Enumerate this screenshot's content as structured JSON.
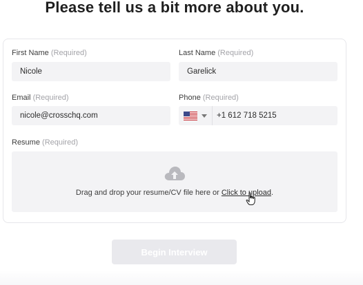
{
  "heading": "Please tell us a bit more about you.",
  "required_tag": "(Required)",
  "fields": {
    "first_name": {
      "label": "First Name",
      "value": "Nicole"
    },
    "last_name": {
      "label": "Last Name",
      "value": "Garelick"
    },
    "email": {
      "label": "Email",
      "value": "nicole@crosschq.com"
    },
    "phone": {
      "label": "Phone",
      "value": "+1 612 718 5215",
      "country": "United States"
    }
  },
  "resume": {
    "label": "Resume",
    "drop_text": "Drag and drop your resume/CV file here or ",
    "upload_link": "Click to upload",
    "period": ".",
    "icon": "cloud-upload-icon"
  },
  "submit_button": {
    "label": "Begin Interview",
    "state": "disabled"
  },
  "colors": {
    "field_background": "#f3f3f5",
    "required_text": "#a3a3a8",
    "button_disabled": "#e9e9ed"
  }
}
